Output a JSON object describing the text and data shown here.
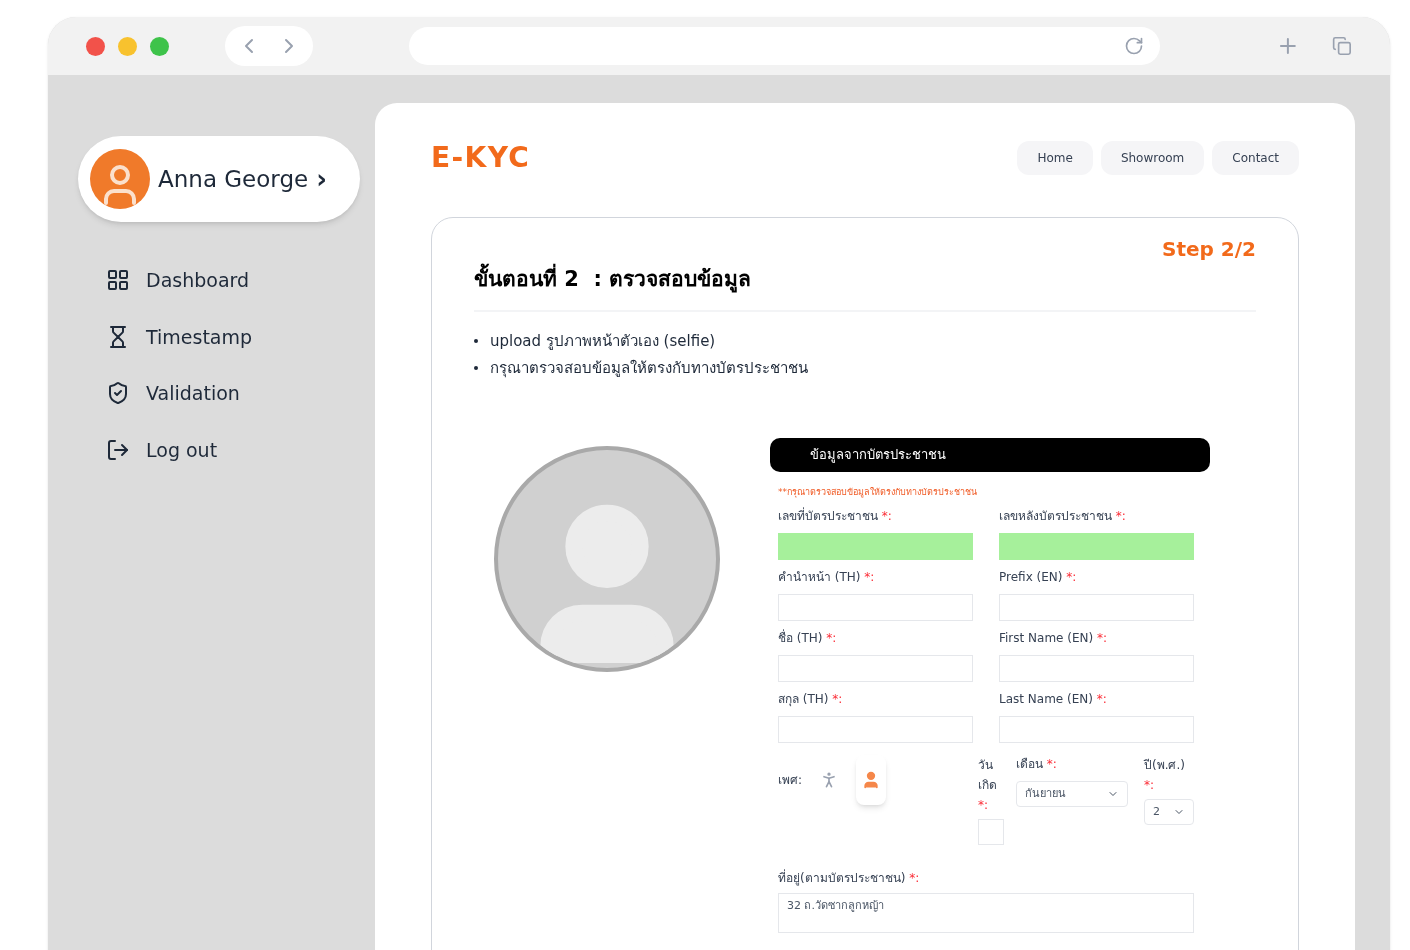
{
  "profile": {
    "name": "Anna George",
    "chevron": "›"
  },
  "sidebar": {
    "items": [
      {
        "label": "Dashboard",
        "kind": "grid"
      },
      {
        "label": "Timestamp",
        "kind": "hourglass"
      },
      {
        "label": "Validation",
        "kind": "shield"
      },
      {
        "label": "Log out",
        "kind": "logout"
      }
    ]
  },
  "header": {
    "logo": "E-KYC",
    "nav": [
      "Home",
      "Showroom",
      "Contact"
    ]
  },
  "step": {
    "badge": "Step 2/2",
    "title": "ขั้นตอนที่ 2  : ตรวจสอบข้อมูล",
    "bullets": [
      "upload รูปภาพหน้าตัวเอง (selfie)",
      "กรุณาตรวจสอบข้อมูลให้ตรงกับทางบัตรประชาชน"
    ]
  },
  "form": {
    "header": "ข้อมูลจากบัตรประชาชน",
    "note": "**กรุณาตรวจสอบข้อมูลให้ตรงกับทางบัตรประชาชน",
    "fields": [
      {
        "label": "เลขที่บัตรประชาชน",
        "highlighted": true
      },
      {
        "label": "เลขหลังบัตรประชาชน",
        "highlighted": true
      },
      {
        "label": "คำนำหน้า (TH)",
        "highlighted": false
      },
      {
        "label": "Prefix (EN)",
        "highlighted": false
      },
      {
        "label": "ชื่อ (TH)",
        "highlighted": false
      },
      {
        "label": "First Name (EN)",
        "highlighted": false
      },
      {
        "label": "สกุล (TH)",
        "highlighted": false
      },
      {
        "label": "Last Name (EN)",
        "highlighted": false
      }
    ],
    "required_mark": "*:",
    "gender": {
      "label": "เพศ:",
      "options": [
        {
          "kind": "male",
          "selected": false
        },
        {
          "kind": "female",
          "selected": true
        }
      ]
    },
    "birth": {
      "day_label": "วันเกิด",
      "month_label": "เดือน",
      "month_value": "กันยายน",
      "year_label": "ปี(พ.ศ.)",
      "year_value": "2"
    },
    "address": {
      "label": "ที่อยู่(ตามบัตรประชาชน)",
      "value": "32 ถ.วัดซากลูกหญ้า"
    }
  }
}
